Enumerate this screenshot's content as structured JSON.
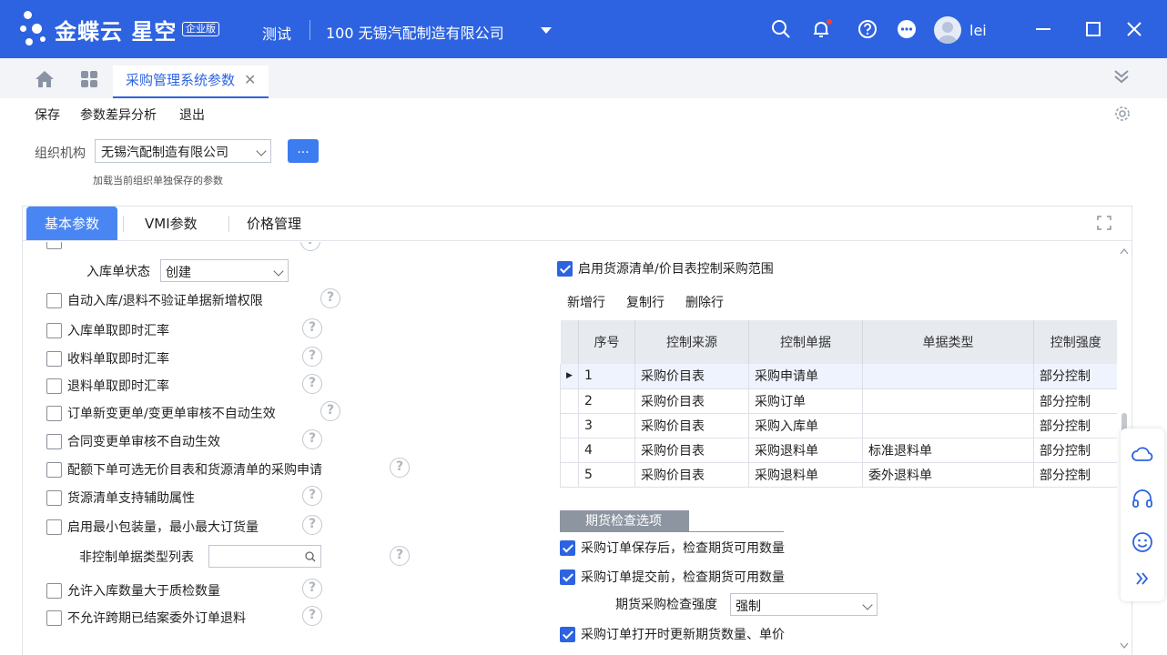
{
  "app": {
    "brand": "金蝶云 星空",
    "edition": "企业版",
    "env": "测试",
    "company": "100  无锡汽配制造有限公司",
    "user": "lei"
  },
  "tabs": {
    "active_label": "采购管理系统参数"
  },
  "toolbar": {
    "save": "保存",
    "diff": "参数差异分析",
    "exit": "退出"
  },
  "org": {
    "label": "组织机构",
    "value": "无锡汽配制造有限公司",
    "button": "...",
    "hint": "加载当前组织单独保存的参数"
  },
  "panel_tabs": [
    "基本参数",
    "VMI参数",
    "价格管理"
  ],
  "left": {
    "inbound_status_label": "入库单状态",
    "inbound_status_value": "创建",
    "options": [
      {
        "label": "自动入库/退料不验证单据新增权限",
        "checked": false
      },
      {
        "label": "入库单取即时汇率",
        "checked": false
      },
      {
        "label": "收料单取即时汇率",
        "checked": false
      },
      {
        "label": "退料单取即时汇率",
        "checked": false
      },
      {
        "label": "订单新变更单/变更单审核不自动生效",
        "checked": false
      },
      {
        "label": "合同变更单审核不自动生效",
        "checked": false
      },
      {
        "label": "配额下单可选无价目表和货源清单的采购申请",
        "checked": false
      },
      {
        "label": "货源清单支持辅助属性",
        "checked": false
      },
      {
        "label": "启用最小包装量，最小最大订货量",
        "checked": false
      }
    ],
    "noncontrol_label": "非控制单据类型列表",
    "noncontrol_value": "",
    "options2": [
      {
        "label": "允许入库数量大于质检数量",
        "checked": false
      },
      {
        "label": "不允许跨期已结案委外订单退料",
        "checked": false
      }
    ]
  },
  "right": {
    "enable_label": "启用货源清单/价目表控制采购范围",
    "enable_checked": true,
    "grid_toolbar": {
      "add": "新增行",
      "copy": "复制行",
      "delete": "删除行"
    },
    "grid_columns": [
      "序号",
      "控制来源",
      "控制单据",
      "单据类型",
      "控制强度"
    ],
    "grid_rows": [
      [
        "1",
        "采购价目表",
        "采购申请单",
        "",
        "部分控制"
      ],
      [
        "2",
        "采购价目表",
        "采购订单",
        "",
        "部分控制"
      ],
      [
        "3",
        "采购价目表",
        "采购入库单",
        "",
        "部分控制"
      ],
      [
        "4",
        "采购价目表",
        "采购退料单",
        "标准退料单",
        "部分控制"
      ],
      [
        "5",
        "采购价目表",
        "采购退料单",
        "委外退料单",
        "部分控制"
      ]
    ],
    "futures_section": "期货检查选项",
    "futures_opt1": "采购订单保存后，检查期货可用数量",
    "futures_opt2": "采购订单提交前，检查期货可用数量",
    "futures_strength_label": "期货采购检查强度",
    "futures_strength_value": "强制",
    "futures_opt3": "采购订单打开时更新期货数量、单价"
  },
  "colors": {
    "accent": "#2d63e0",
    "tab_active": "#4a86f3"
  }
}
